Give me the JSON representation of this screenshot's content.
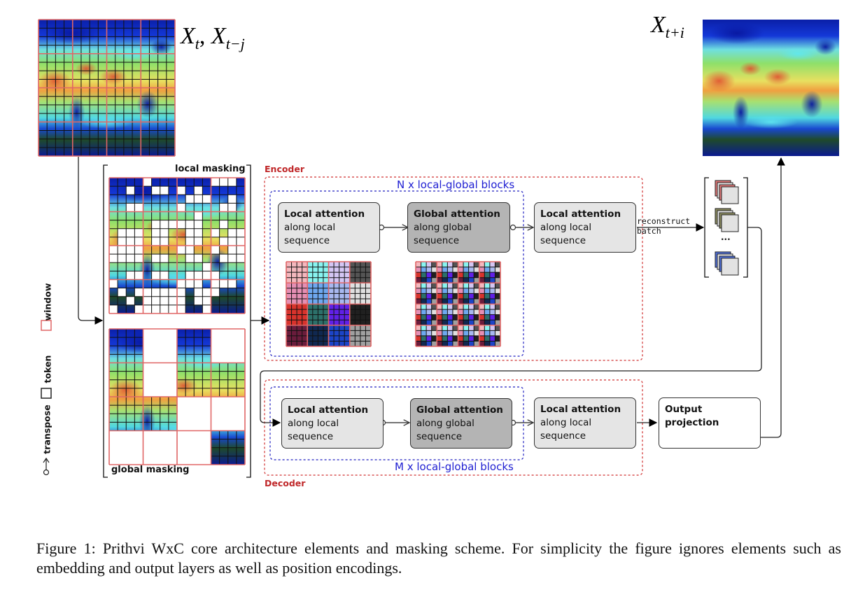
{
  "inputs": {
    "input_label_main": "X",
    "input_sub1": "t",
    "input_comma": ", ",
    "input_sub2": "t−j",
    "output_label_main": "X",
    "output_sub": "t+i"
  },
  "masking": {
    "local_label": "local masking",
    "global_label": "global masking",
    "grid_tokens": 16,
    "grid_windows": 4,
    "local_mask": [
      "0000100000001110",
      "0010011010100000",
      "0000000001110010",
      "0011000010000110",
      "0000000000100000",
      "0000011111100100",
      "0111011001101011",
      "0111011001100111",
      "1111000011001011",
      "1111011001100111",
      "0000000000010000",
      "0011011001111000",
      "1000000011101110",
      "0101111110111000",
      "0010111110110000",
      "1001111110010000"
    ],
    "global_mask": [
      "0101",
      "0100",
      "0011",
      "1110"
    ]
  },
  "legend": {
    "window_label": "window",
    "token_label": "token",
    "transpose_label": "transpose",
    "window_color": "#e06666",
    "token_color": "#222222"
  },
  "encoder": {
    "section_label": "Encoder",
    "blocks_label": "N x local-global blocks",
    "local1": {
      "title": "Local attention",
      "line1": "along local",
      "line2": "sequence"
    },
    "global1": {
      "title": "Global attention",
      "line1": "along global",
      "line2": "sequence"
    },
    "local2": {
      "title": "Local attention",
      "line1": "along local",
      "line2": "sequence"
    },
    "window_colors": [
      [
        "#f4b8be",
        "#88f4f0",
        "#d4c6f4",
        "#545454"
      ],
      [
        "#e58fb4",
        "#6ea8f0",
        "#a8b8f0",
        "#e0e0e0"
      ],
      [
        "#d8332c",
        "#2c706a",
        "#6020e8",
        "#202020"
      ],
      [
        "#6a1c3c",
        "#102850",
        "#1c44c8",
        "#a0a0a0"
      ]
    ]
  },
  "reconstruct": {
    "label_line1": "reconstruct",
    "label_line2": "batch",
    "ellipsis": "...",
    "stack_colors": [
      "#e07878",
      "#8c8c60",
      "#5070d8"
    ]
  },
  "decoder": {
    "section_label": "Decoder",
    "blocks_label": "M x local-global blocks",
    "local1": {
      "title": "Local attention",
      "line1": "along local",
      "line2": "sequence"
    },
    "global1": {
      "title": "Global attention",
      "line1": "along global",
      "line2": "sequence"
    },
    "local2": {
      "title": "Local attention",
      "line1": "along local",
      "line2": "sequence"
    },
    "output_projection": "Output projection"
  },
  "caption": {
    "text": "Figure 1: Prithvi WxC core architecture elements and masking scheme. For simplicity the figure ignores elements such as embedding and output layers as well as position encodings."
  }
}
